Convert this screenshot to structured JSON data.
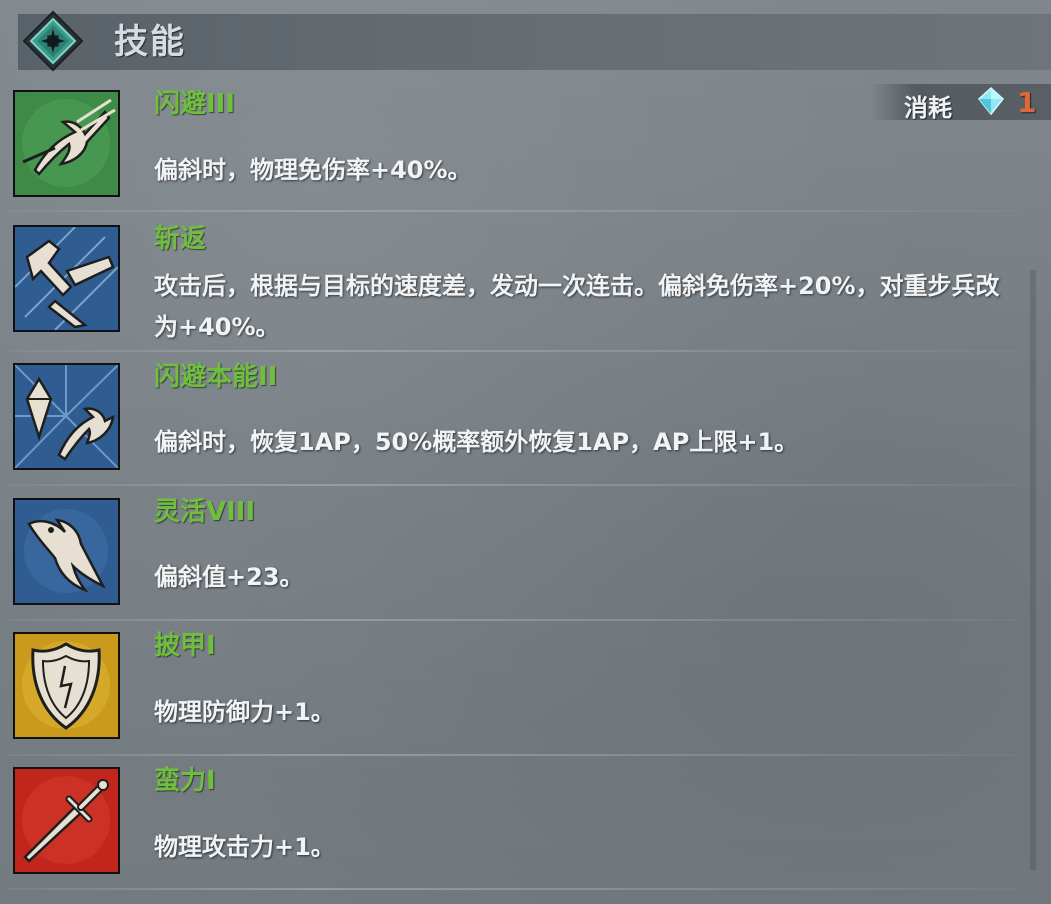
{
  "header": {
    "title": "技能",
    "badge_icon": "star-emblem-icon"
  },
  "cost": {
    "label": "消耗",
    "icon": "diamond-icon",
    "value": "1",
    "value_color": "#e0673a"
  },
  "skills": [
    {
      "name": "闪避III",
      "desc": "偏斜时，物理免伤率+40%。",
      "icon": "dodge-icon",
      "icon_bg": "#3f8a46"
    },
    {
      "name": "斩返",
      "desc": "攻击后，根据与目标的速度差，发动一次连击。偏斜免伤率+20%，对重步兵改为+40%。",
      "icon": "counter-strike-icon",
      "icon_bg": "#2f5c91"
    },
    {
      "name": "闪避本能II",
      "desc": "偏斜时，恢复1AP，50%概率额外恢复1AP，AP上限+1。",
      "icon": "dodge-instinct-icon",
      "icon_bg": "#2f5c91"
    },
    {
      "name": "灵活VIII",
      "desc": "偏斜值+23。",
      "icon": "agility-icon",
      "icon_bg": "#2f5c91"
    },
    {
      "name": "披甲I",
      "desc": "物理防御力+1。",
      "icon": "shield-icon",
      "icon_bg": "#c99a1c"
    },
    {
      "name": "蛮力I",
      "desc": "物理攻击力+1。",
      "icon": "sword-icon",
      "icon_bg": "#c0261c"
    }
  ],
  "colors": {
    "skill_name": "#6fbf3d",
    "desc_text": "#f2f3f4"
  }
}
